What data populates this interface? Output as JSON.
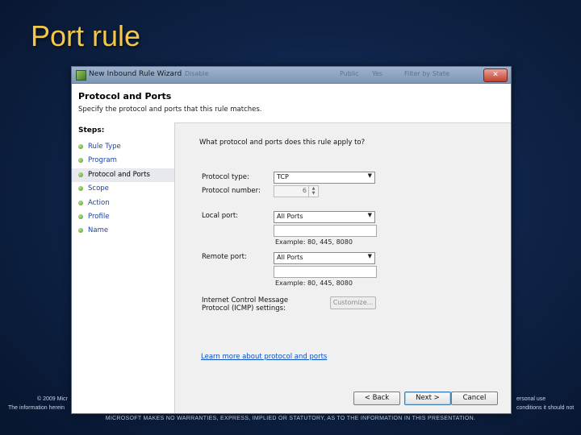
{
  "slide": {
    "title": "Port rule",
    "footer_left_1": "© 2009 Micr",
    "footer_left_2": "The information herein",
    "footer_right_1": "ersonal use",
    "footer_right_2": "conditions it should not",
    "footer_center": "MICROSOFT MAKES NO WARRANTIES, EXPRESS, IMPLIED OR STATUTORY, AS TO THE INFORMATION IN THIS PRESENTATION."
  },
  "window": {
    "title": "New Inbound Rule Wizard",
    "ghost_text_1": "Disable",
    "ghost_text_2": "Public",
    "ghost_text_3": "Yes",
    "ghost_text_4": "Filter by State",
    "close_glyph": "✕",
    "header_title": "Protocol and Ports",
    "header_subtitle": "Specify the protocol and ports that this rule matches.",
    "accent_color": "#1c3fa8"
  },
  "steps": {
    "label": "Steps:",
    "items": [
      {
        "label": "Rule Type"
      },
      {
        "label": "Program"
      },
      {
        "label": "Protocol and Ports"
      },
      {
        "label": "Scope"
      },
      {
        "label": "Action"
      },
      {
        "label": "Profile"
      },
      {
        "label": "Name"
      }
    ],
    "selected_index": 2
  },
  "form": {
    "question": "What protocol and ports does this rule apply to?",
    "protocol_type_label": "Protocol type:",
    "protocol_type_value": "TCP",
    "protocol_number_label": "Protocol number:",
    "protocol_number_value": "6",
    "local_port_label": "Local port:",
    "local_port_value": "All Ports",
    "local_port_example": "Example: 80, 445, 8080",
    "remote_port_label": "Remote port:",
    "remote_port_value": "All Ports",
    "remote_port_example": "Example: 80, 445, 8080",
    "icmp_label": "Internet Control Message Protocol (ICMP) settings:",
    "customize_label": "Customize...",
    "learn_more_link": "Learn more about protocol and ports"
  },
  "buttons": {
    "back": "< Back",
    "next": "Next >",
    "cancel": "Cancel"
  }
}
